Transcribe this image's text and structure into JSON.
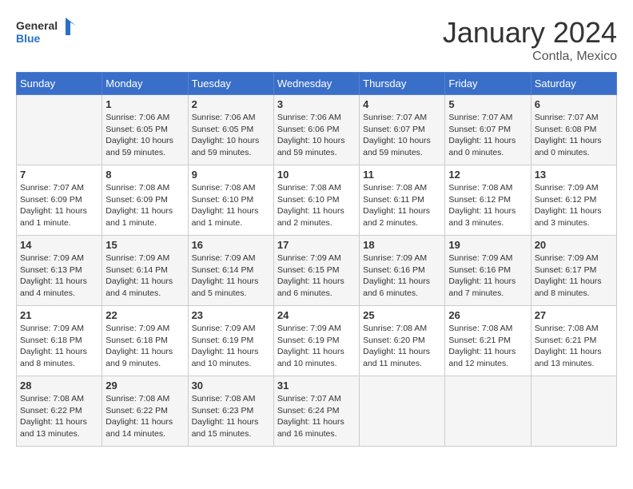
{
  "header": {
    "logo_general": "General",
    "logo_blue": "Blue",
    "month_title": "January 2024",
    "subtitle": "Contla, Mexico"
  },
  "columns": [
    "Sunday",
    "Monday",
    "Tuesday",
    "Wednesday",
    "Thursday",
    "Friday",
    "Saturday"
  ],
  "weeks": [
    [
      {
        "day": "",
        "info": ""
      },
      {
        "day": "1",
        "info": "Sunrise: 7:06 AM\nSunset: 6:05 PM\nDaylight: 10 hours\nand 59 minutes."
      },
      {
        "day": "2",
        "info": "Sunrise: 7:06 AM\nSunset: 6:05 PM\nDaylight: 10 hours\nand 59 minutes."
      },
      {
        "day": "3",
        "info": "Sunrise: 7:06 AM\nSunset: 6:06 PM\nDaylight: 10 hours\nand 59 minutes."
      },
      {
        "day": "4",
        "info": "Sunrise: 7:07 AM\nSunset: 6:07 PM\nDaylight: 10 hours\nand 59 minutes."
      },
      {
        "day": "5",
        "info": "Sunrise: 7:07 AM\nSunset: 6:07 PM\nDaylight: 11 hours\nand 0 minutes."
      },
      {
        "day": "6",
        "info": "Sunrise: 7:07 AM\nSunset: 6:08 PM\nDaylight: 11 hours\nand 0 minutes."
      }
    ],
    [
      {
        "day": "7",
        "info": "Sunrise: 7:07 AM\nSunset: 6:09 PM\nDaylight: 11 hours\nand 1 minute."
      },
      {
        "day": "8",
        "info": "Sunrise: 7:08 AM\nSunset: 6:09 PM\nDaylight: 11 hours\nand 1 minute."
      },
      {
        "day": "9",
        "info": "Sunrise: 7:08 AM\nSunset: 6:10 PM\nDaylight: 11 hours\nand 1 minute."
      },
      {
        "day": "10",
        "info": "Sunrise: 7:08 AM\nSunset: 6:10 PM\nDaylight: 11 hours\nand 2 minutes."
      },
      {
        "day": "11",
        "info": "Sunrise: 7:08 AM\nSunset: 6:11 PM\nDaylight: 11 hours\nand 2 minutes."
      },
      {
        "day": "12",
        "info": "Sunrise: 7:08 AM\nSunset: 6:12 PM\nDaylight: 11 hours\nand 3 minutes."
      },
      {
        "day": "13",
        "info": "Sunrise: 7:09 AM\nSunset: 6:12 PM\nDaylight: 11 hours\nand 3 minutes."
      }
    ],
    [
      {
        "day": "14",
        "info": "Sunrise: 7:09 AM\nSunset: 6:13 PM\nDaylight: 11 hours\nand 4 minutes."
      },
      {
        "day": "15",
        "info": "Sunrise: 7:09 AM\nSunset: 6:14 PM\nDaylight: 11 hours\nand 4 minutes."
      },
      {
        "day": "16",
        "info": "Sunrise: 7:09 AM\nSunset: 6:14 PM\nDaylight: 11 hours\nand 5 minutes."
      },
      {
        "day": "17",
        "info": "Sunrise: 7:09 AM\nSunset: 6:15 PM\nDaylight: 11 hours\nand 6 minutes."
      },
      {
        "day": "18",
        "info": "Sunrise: 7:09 AM\nSunset: 6:16 PM\nDaylight: 11 hours\nand 6 minutes."
      },
      {
        "day": "19",
        "info": "Sunrise: 7:09 AM\nSunset: 6:16 PM\nDaylight: 11 hours\nand 7 minutes."
      },
      {
        "day": "20",
        "info": "Sunrise: 7:09 AM\nSunset: 6:17 PM\nDaylight: 11 hours\nand 8 minutes."
      }
    ],
    [
      {
        "day": "21",
        "info": "Sunrise: 7:09 AM\nSunset: 6:18 PM\nDaylight: 11 hours\nand 8 minutes."
      },
      {
        "day": "22",
        "info": "Sunrise: 7:09 AM\nSunset: 6:18 PM\nDaylight: 11 hours\nand 9 minutes."
      },
      {
        "day": "23",
        "info": "Sunrise: 7:09 AM\nSunset: 6:19 PM\nDaylight: 11 hours\nand 10 minutes."
      },
      {
        "day": "24",
        "info": "Sunrise: 7:09 AM\nSunset: 6:19 PM\nDaylight: 11 hours\nand 10 minutes."
      },
      {
        "day": "25",
        "info": "Sunrise: 7:08 AM\nSunset: 6:20 PM\nDaylight: 11 hours\nand 11 minutes."
      },
      {
        "day": "26",
        "info": "Sunrise: 7:08 AM\nSunset: 6:21 PM\nDaylight: 11 hours\nand 12 minutes."
      },
      {
        "day": "27",
        "info": "Sunrise: 7:08 AM\nSunset: 6:21 PM\nDaylight: 11 hours\nand 13 minutes."
      }
    ],
    [
      {
        "day": "28",
        "info": "Sunrise: 7:08 AM\nSunset: 6:22 PM\nDaylight: 11 hours\nand 13 minutes."
      },
      {
        "day": "29",
        "info": "Sunrise: 7:08 AM\nSunset: 6:22 PM\nDaylight: 11 hours\nand 14 minutes."
      },
      {
        "day": "30",
        "info": "Sunrise: 7:08 AM\nSunset: 6:23 PM\nDaylight: 11 hours\nand 15 minutes."
      },
      {
        "day": "31",
        "info": "Sunrise: 7:07 AM\nSunset: 6:24 PM\nDaylight: 11 hours\nand 16 minutes."
      },
      {
        "day": "",
        "info": ""
      },
      {
        "day": "",
        "info": ""
      },
      {
        "day": "",
        "info": ""
      }
    ]
  ]
}
